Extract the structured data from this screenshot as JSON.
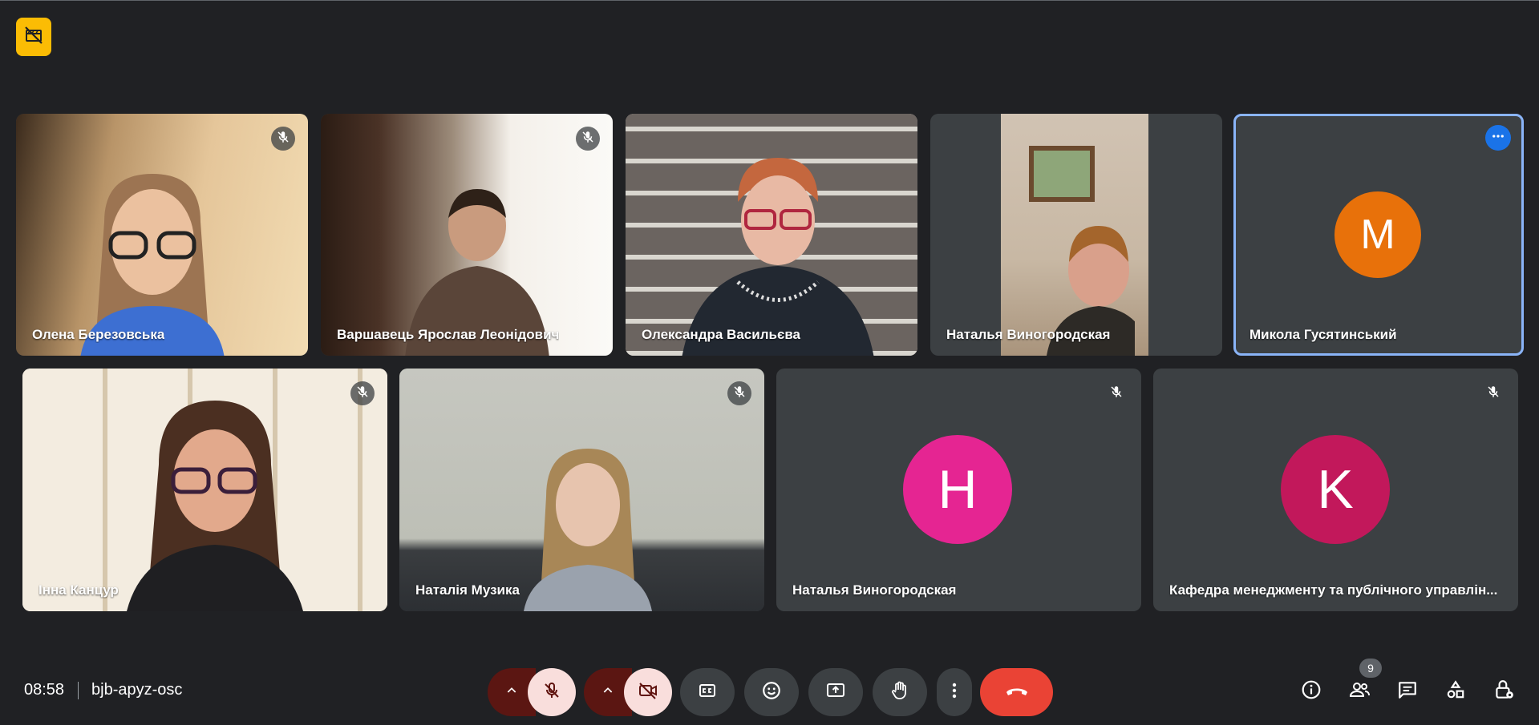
{
  "meeting": {
    "time": "08:58",
    "code": "bjb-apyz-osc",
    "participant_count": "9"
  },
  "participants": [
    {
      "name": "Олена Березовська",
      "muted": true
    },
    {
      "name": "Варшавець Ярослав Леонідович",
      "muted": true
    },
    {
      "name": "Олександра Васильєва",
      "muted": false
    },
    {
      "name": "Наталья Виногородская",
      "muted": false
    },
    {
      "name": "Микола Гусятинський",
      "initial": "M",
      "avatar_color": "#e8710a",
      "active": true
    },
    {
      "name": "Інна Канцур",
      "muted": true
    },
    {
      "name": "Наталія Музика",
      "muted": true
    },
    {
      "name": "Наталья Виногородская",
      "initial": "H",
      "avatar_color": "#e52592",
      "muted": true
    },
    {
      "name": "Кафедра менеджменту та публічного управлін...",
      "initial": "K",
      "avatar_color": "#c2185b",
      "muted": true
    }
  ],
  "colors": {
    "background": "#202124",
    "tile": "#3c4043",
    "active_outline": "#8ab4f8",
    "end_call": "#ea4335",
    "muted_control": "#f9dedc",
    "badge": "#fbbc04"
  },
  "icons": {
    "top_badge": "no-recording-icon",
    "controls": [
      "chevron-up-icon",
      "mic-off-icon",
      "chevron-up-icon",
      "camera-off-icon",
      "captions-icon",
      "emoji-icon",
      "present-icon",
      "raise-hand-icon",
      "more-vert-icon",
      "call-end-icon"
    ],
    "right": [
      "info-icon",
      "people-icon",
      "chat-icon",
      "activities-icon",
      "host-controls-icon"
    ]
  }
}
